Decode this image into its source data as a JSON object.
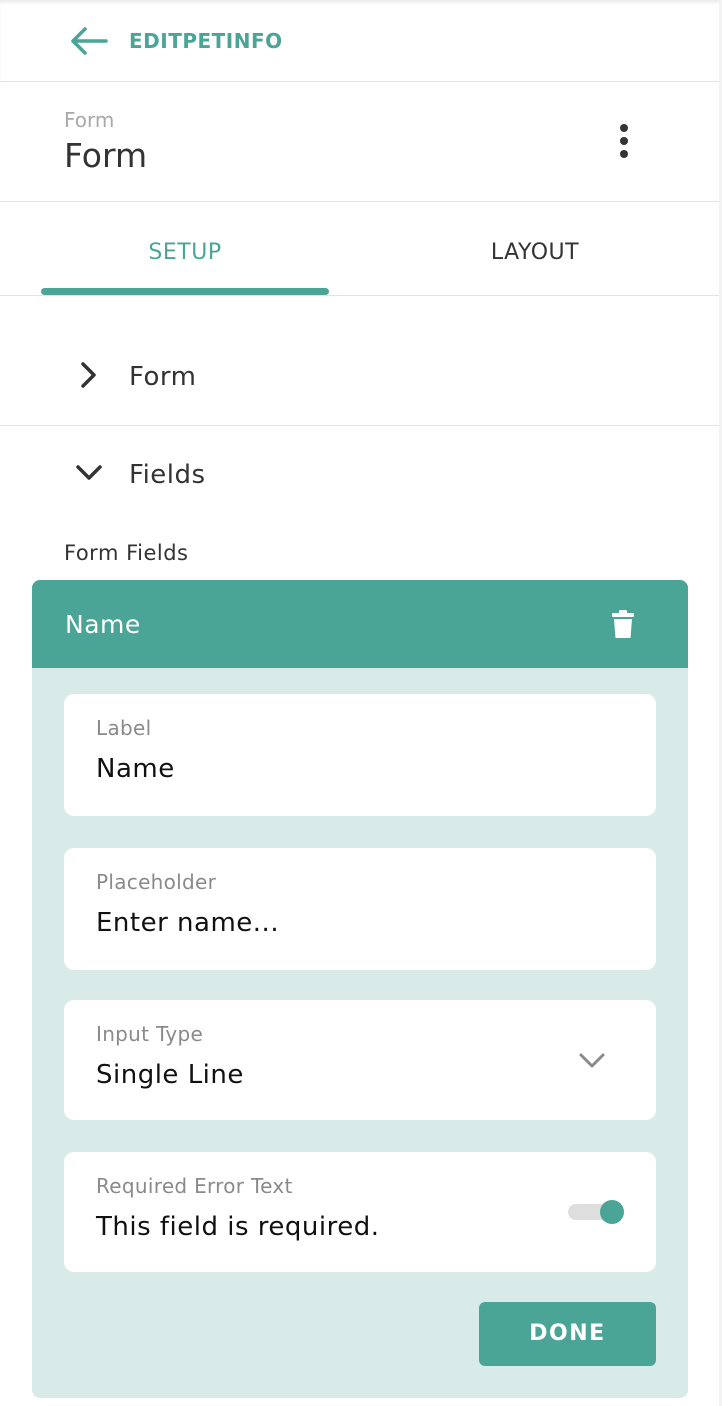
{
  "topbar": {
    "title": "EDITPETINFO",
    "back_icon": "arrow-left-icon"
  },
  "header": {
    "overline": "Form",
    "title": "Form",
    "menu_icon": "more-vertical-icon"
  },
  "tabs": [
    {
      "label": "SETUP",
      "active": true
    },
    {
      "label": "LAYOUT",
      "active": false
    }
  ],
  "sections": {
    "form": {
      "label": "Form",
      "expanded": false,
      "icon": "chevron-right-icon"
    },
    "fields": {
      "label": "Fields",
      "expanded": true,
      "icon": "chevron-down-icon"
    }
  },
  "form_fields_label": "Form Fields",
  "field_card": {
    "title": "Name",
    "delete_icon": "trash-icon",
    "label": {
      "label": "Label",
      "value": "Name"
    },
    "placeholder": {
      "label": "Placeholder",
      "value": "Enter name..."
    },
    "input_type": {
      "label": "Input Type",
      "value": "Single Line",
      "icon": "chevron-down-icon"
    },
    "required_error": {
      "label": "Required Error Text",
      "value": "This field is required.",
      "toggle_on": true
    },
    "done_label": "DONE"
  },
  "colors": {
    "accent": "#4aa596",
    "card_background": "#d9ebe8",
    "text": "#333333",
    "muted": "#8a8a8a"
  }
}
